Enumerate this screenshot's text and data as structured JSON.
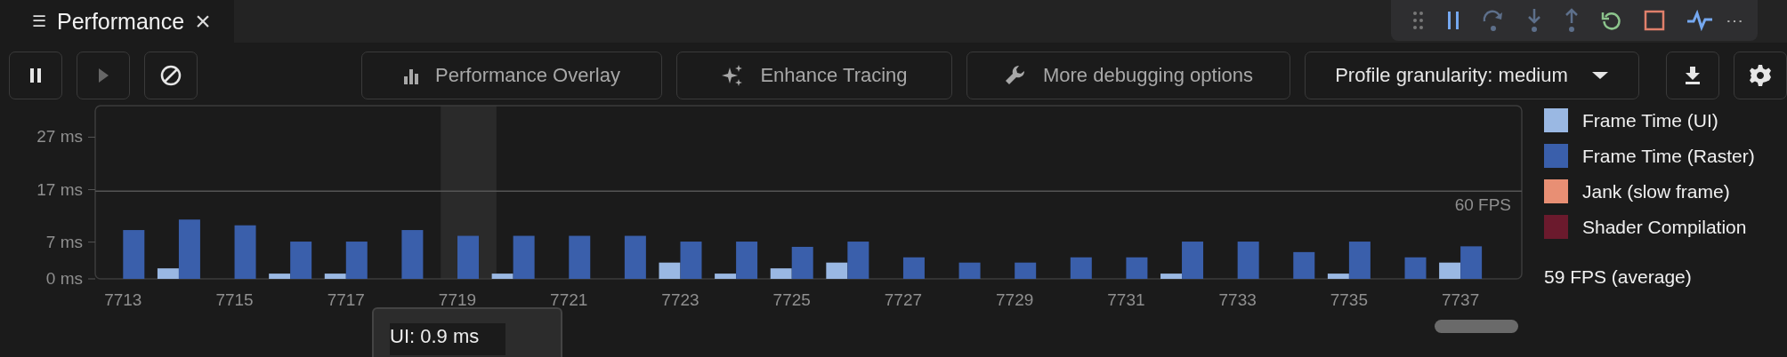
{
  "tab": {
    "icon": "☰",
    "title": "Performance",
    "close": "×",
    "selected": true
  },
  "debug_toolbar": {
    "more": "⋯"
  },
  "toolbar": {
    "buttons": [
      {
        "kind": "pause",
        "disabled": false
      },
      {
        "kind": "play",
        "disabled": true
      },
      {
        "kind": "clear",
        "disabled": false
      },
      {
        "kind": "overlay",
        "label": "Performance Overlay",
        "disabled": true
      },
      {
        "kind": "enhance",
        "label": "Enhance Tracing",
        "disabled": true
      },
      {
        "kind": "wrench",
        "label": "More debugging options",
        "disabled": true
      },
      {
        "kind": "dropdown",
        "label": "Profile granularity: medium",
        "disabled": false
      },
      {
        "kind": "download",
        "disabled": false
      },
      {
        "kind": "settings",
        "disabled": false
      }
    ]
  },
  "chart": {
    "chart_data": {
      "type": "bar",
      "x": [
        7713,
        7714,
        7715,
        7716,
        7717,
        7718,
        7719,
        7720,
        7721,
        7722,
        7723,
        7724,
        7725,
        7726,
        7727,
        7728,
        7729,
        7730,
        7731,
        7732,
        7733,
        7734,
        7735,
        7736,
        7737
      ],
      "series": [
        {
          "name": "Frame Time (UI)",
          "color": "#9ab8e3",
          "values": [
            0,
            2.0,
            0,
            1.0,
            1.0,
            0,
            0,
            1.0,
            0,
            0,
            3.1,
            1.0,
            2.0,
            3.1,
            0,
            0,
            0,
            0,
            0,
            1.0,
            0,
            0,
            1.0,
            0,
            3.1
          ]
        },
        {
          "name": "Frame Time (Raster)",
          "color": "#3a5fab",
          "values": [
            9.3,
            11.3,
            10.2,
            7.1,
            7.1,
            9.3,
            8.2,
            8.2,
            8.2,
            8.2,
            7.1,
            7.1,
            6.1,
            7.1,
            4.1,
            3.1,
            3.1,
            4.1,
            4.1,
            7.1,
            7.1,
            5.1,
            7.1,
            4.1,
            6.2
          ]
        },
        {
          "name": "Jank (slow frame)",
          "color": "#e88f74",
          "values": [
            0,
            0,
            0,
            0,
            0,
            0,
            0,
            0,
            0,
            0,
            0,
            0,
            0,
            0,
            0,
            0,
            0,
            0,
            0,
            0,
            0,
            0,
            0,
            0,
            0
          ]
        },
        {
          "name": "Shader Compilation",
          "color": "#6b1a2d",
          "values": [
            0,
            0,
            0,
            0,
            0,
            0,
            0,
            0,
            0,
            0,
            0,
            0,
            0,
            0,
            0,
            0,
            0,
            0,
            0,
            0,
            0,
            0,
            0,
            0,
            0
          ]
        }
      ],
      "xlim": [
        7712.5,
        7738.1
      ],
      "ylim": [
        0,
        33
      ],
      "yticks": [
        {
          "value": 0,
          "label": "0 ms"
        },
        {
          "value": 7,
          "label": "7 ms"
        },
        {
          "value": 17,
          "label": "17 ms"
        },
        {
          "value": 27,
          "label": "27 ms"
        }
      ],
      "xticks": [
        7713,
        7715,
        7717,
        7719,
        7721,
        7723,
        7725,
        7727,
        7729,
        7731,
        7733,
        7735,
        7737
      ],
      "ref_lines": [
        {
          "axis": "y",
          "value": 16.7,
          "label": "60 FPS"
        }
      ],
      "bands": [
        {
          "axis": "x",
          "from": 7718.7,
          "to": 7719.7
        }
      ]
    },
    "tooltip": {
      "text": "UI: 0.9 ms"
    }
  },
  "average": "59 FPS (average)"
}
